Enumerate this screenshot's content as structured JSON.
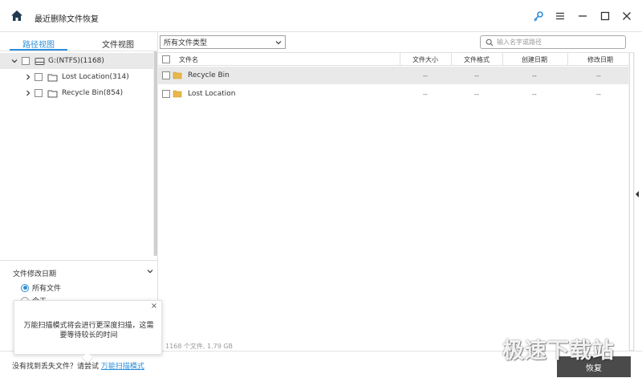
{
  "app": {
    "title": "最近删除文件恢复"
  },
  "left_panel": {
    "tabs": [
      "路径视图",
      "文件视图"
    ],
    "tree": {
      "root": "G:(NTFS)(1168)",
      "children": [
        "Lost Location(314)",
        "Recycle Bin(854)"
      ]
    },
    "filter": {
      "title": "文件修改日期",
      "options": [
        "所有文件",
        "今天"
      ]
    }
  },
  "toolbar": {
    "file_type_select": "所有文件类型",
    "search_placeholder": "输入名字或路径"
  },
  "table": {
    "columns": [
      "文件名",
      "文件大小",
      "文件格式",
      "创建日期",
      "修改日期"
    ],
    "rows": [
      {
        "name": "Recycle Bin",
        "size": "--",
        "format": "--",
        "created": "--",
        "modified": "--"
      },
      {
        "name": "Lost Location",
        "size": "--",
        "format": "--",
        "created": "--",
        "modified": "--"
      }
    ]
  },
  "status": {
    "summary": "1168 个文件, 1.79 GB"
  },
  "tooltip": {
    "line1": "万能扫描模式将会进行更深度扫描，这需",
    "line2": "要等待较长的时间",
    "close": "×"
  },
  "bottom_bar": {
    "message": "没有找到丢失文件？请尝试",
    "link": "万能扫描模式",
    "recover_button": "恢复"
  },
  "watermark": "极速下载站",
  "colors": {
    "accent": "#2e8ed8",
    "folder": "#e8b84a",
    "selected_row": "#e9e9e9",
    "button_dark": "#4a4a4a"
  }
}
